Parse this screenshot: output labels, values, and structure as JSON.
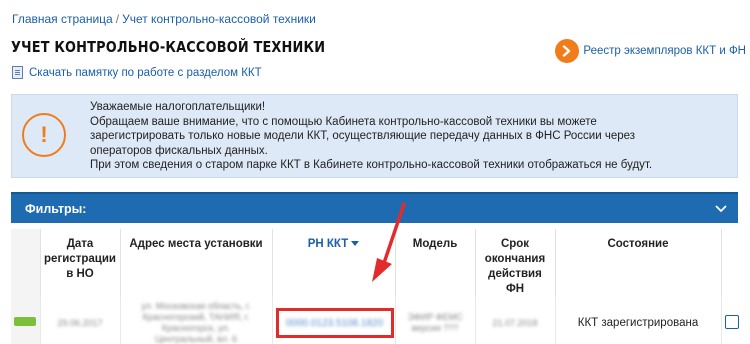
{
  "breadcrumb": {
    "home": "Главная страница",
    "separator": "/",
    "current": "Учет контрольно-кассовой техники"
  },
  "header": {
    "title": "УЧЕТ КОНТРОЛЬНО-КАССОВОЙ ТЕХНИКИ",
    "download_link": "Скачать памятку по работе с разделом ККТ",
    "registry_link": "Реестр экземпляров ККТ и ФН"
  },
  "notice": {
    "lines": [
      "Уважаемые налогоплательщики!",
      "Обращаем ваше внимание, что с помощью Кабинета контрольно-кассовой техники вы можете",
      "зарегистрировать только новые модели ККТ, осуществляющие передачу данных в ФНС России через",
      "операторов фискальных данных.",
      "При этом сведения о старом парке ККТ в Кабинете контрольно-кассовой техники отображаться не будут."
    ],
    "icon_glyph": "!"
  },
  "filters": {
    "label": "Фильтры:"
  },
  "table": {
    "headers": {
      "date": [
        "Дата",
        "регистрации",
        "в НО"
      ],
      "address": "Адрес места установки",
      "rn": "РН ККТ",
      "model": "Модель",
      "term": [
        "Срок",
        "окончания",
        "действия ФН"
      ],
      "state": "Состояние"
    },
    "row": {
      "date": "29.06.2017",
      "address": [
        "ул. Московская область, г.",
        "Красногорский, ТАНИЯ, г.",
        "Красногорск, ул.",
        "Центральный, вл. 6"
      ],
      "rn": "0000.0123.5108.1820",
      "model": [
        "ЭФИР ФЕМС",
        "версия ???"
      ],
      "term": "21.07.2018",
      "state": "ККТ зарегистрирована"
    }
  },
  "colors": {
    "accent_blue": "#1e6bb2",
    "orange": "#f07d1a",
    "highlight_red": "#e32b2b",
    "status_green": "#7dbf3b",
    "notice_bg": "#dde9f6"
  }
}
